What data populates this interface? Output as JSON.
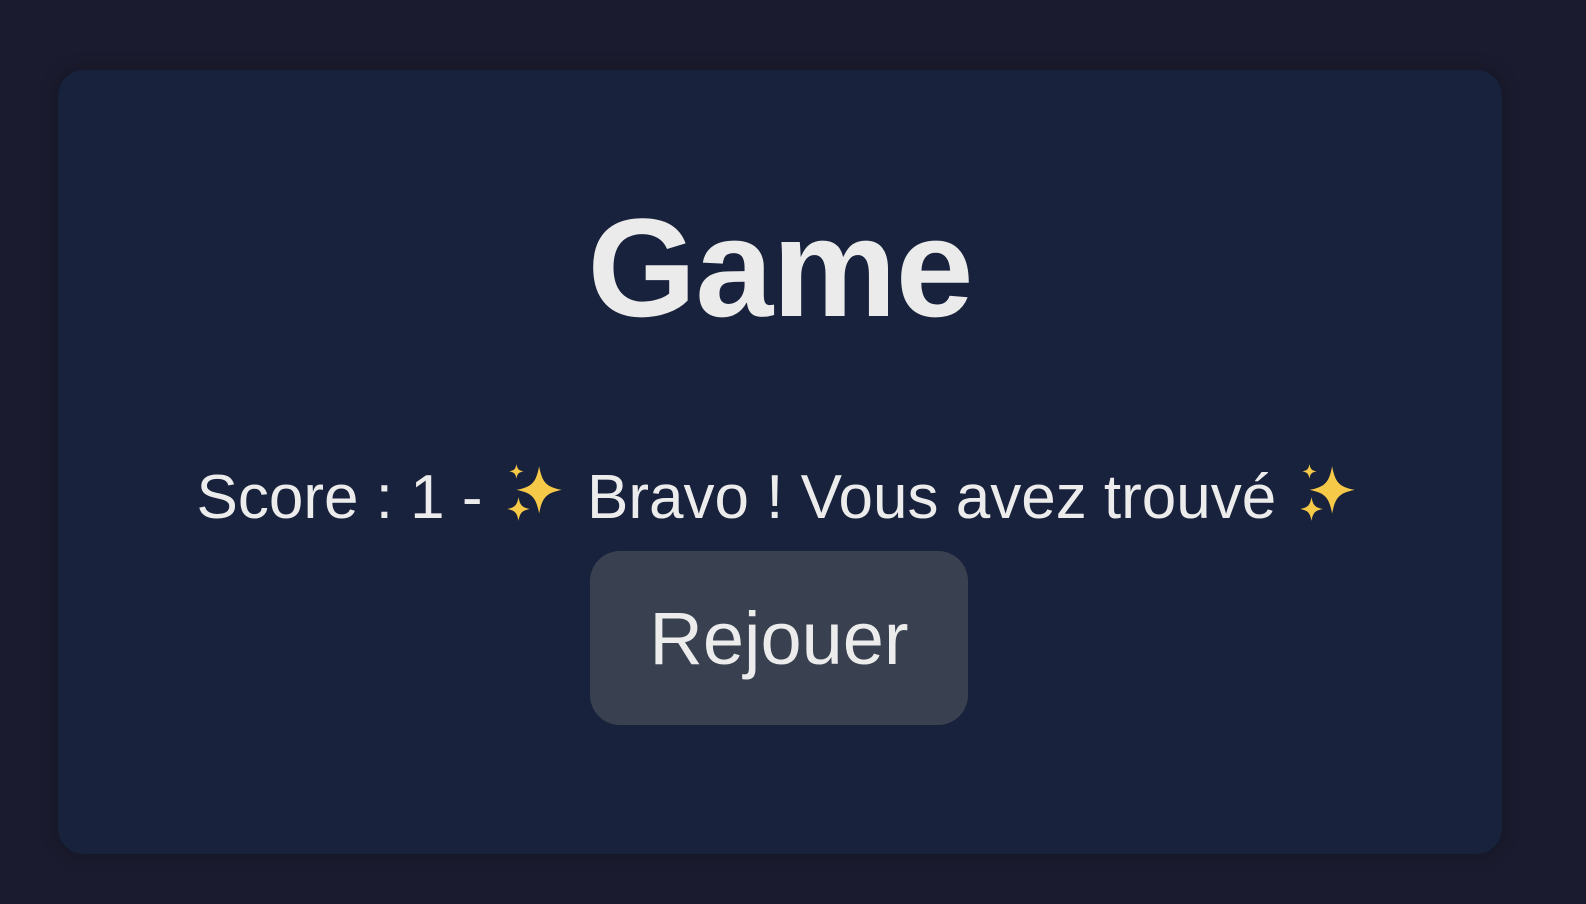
{
  "game": {
    "title": "Game",
    "score_label": "Score : 1 - ",
    "message_text": " Bravo ! Vous avez trouvé ",
    "replay_label": "Rejouer"
  },
  "icons": {
    "left": "sparkles-icon",
    "right": "sparkles-icon"
  },
  "colors": {
    "background": "#1a1b2e",
    "card": "#18223c",
    "button": "#394150",
    "text": "#ececec",
    "sparkle": "#f7c948"
  }
}
